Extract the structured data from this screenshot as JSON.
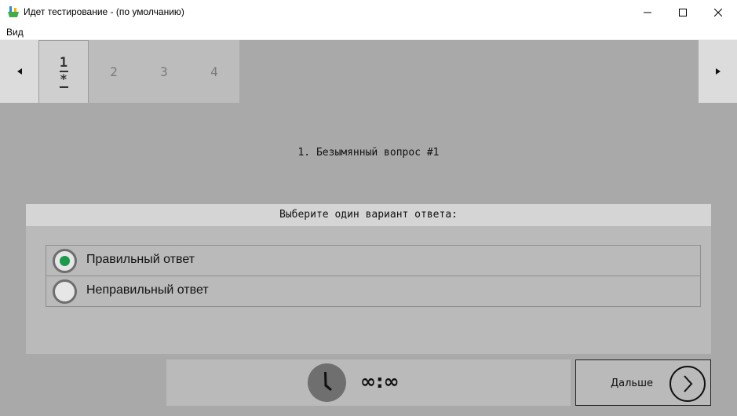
{
  "window": {
    "title": "Идет тестирование - (по умолчанию)"
  },
  "menu": {
    "items": [
      "Вид"
    ]
  },
  "tabs": {
    "prev_icon": "triangle-left-icon",
    "next_icon": "triangle-right-icon",
    "items": [
      {
        "label": "1",
        "marker": "*",
        "active": true
      },
      {
        "label": "2",
        "active": false
      },
      {
        "label": "3",
        "active": false
      },
      {
        "label": "4",
        "active": false
      }
    ]
  },
  "question": {
    "title": "1. Безымянный вопрос #1"
  },
  "answers": {
    "header": "Выберите один вариант ответа:",
    "options": [
      {
        "label": "Правильный ответ",
        "selected": true
      },
      {
        "label": "Неправильный ответ",
        "selected": false
      }
    ]
  },
  "timer": {
    "value": "∞:∞",
    "icon": "clock-icon"
  },
  "next_button": {
    "label": "Дальше",
    "icon": "chevron-right-circle-icon"
  },
  "colors": {
    "background": "#a9a9a9",
    "selected_radio": "#1c9a4b"
  }
}
